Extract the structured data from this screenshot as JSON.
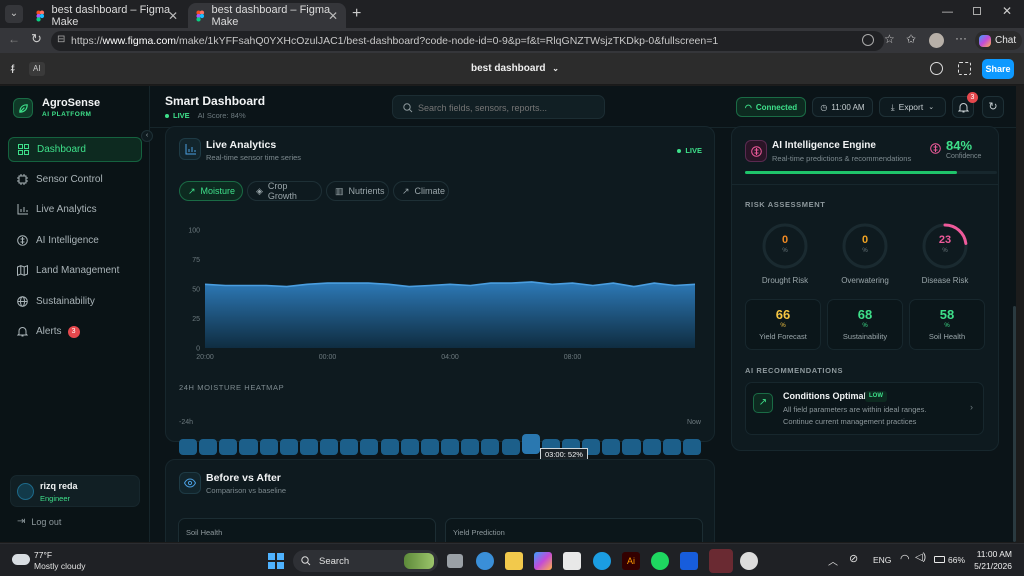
{
  "browser": {
    "tabs": [
      {
        "title": "best dashboard – Figma Make"
      },
      {
        "title": "best dashboard – Figma Make"
      }
    ],
    "url_prefix": "https://",
    "url_domain": "www.figma.com",
    "url_path": "/make/1kYFFsahQ0YXHcOzulJAC1/best-dashboard?code-node-id=0-9&p=f&t=RlqGNZTWsjzTKDkp-0&fullscreen=1",
    "chat_label": "Chat"
  },
  "figma": {
    "ai_badge": "AI",
    "file_title": "best dashboard",
    "share_label": "Share"
  },
  "sidebar": {
    "brand_name": "AgroSense",
    "brand_sub": "AI PLATFORM",
    "items": [
      {
        "label": "Dashboard",
        "icon": "grid-icon"
      },
      {
        "label": "Sensor Control",
        "icon": "cpu-icon"
      },
      {
        "label": "Live Analytics",
        "icon": "bar-chart-icon"
      },
      {
        "label": "AI Intelligence",
        "icon": "brain-icon"
      },
      {
        "label": "Land Management",
        "icon": "map-icon"
      },
      {
        "label": "Sustainability",
        "icon": "globe-icon"
      },
      {
        "label": "Alerts",
        "icon": "bell-icon",
        "badge": "3"
      }
    ],
    "user_name": "rizq reda",
    "user_role": "Engineer",
    "logout_label": "Log out"
  },
  "header": {
    "title": "Smart Dashboard",
    "live_label": "LIVE",
    "ai_score": "AI Score: 84%",
    "search_placeholder": "Search fields, sensors, reports...",
    "connected_label": "Connected",
    "time_label": "11:00 AM",
    "export_label": "Export",
    "notif_count": "3"
  },
  "analytics": {
    "title": "Live Analytics",
    "subtitle": "Real-time sensor time series",
    "live_label": "LIVE",
    "tabs": [
      "Moisture",
      "Crop Growth",
      "Nutrients",
      "Climate"
    ],
    "active_tab": "Moisture",
    "heatmap_title": "24H MOISTURE HEATMAP",
    "heatmap_start": "-24h",
    "heatmap_end": "Now",
    "heatmap_tooltip": "03:00: 52%"
  },
  "chart_data": {
    "type": "area",
    "title": "",
    "xlabel": "",
    "ylabel": "",
    "ylim": [
      0,
      100
    ],
    "y_ticks": [
      "100",
      "75",
      "50",
      "25",
      "0"
    ],
    "x_ticks": [
      "20:00",
      "00:00",
      "04:00",
      "08:00"
    ],
    "color": "#4a9ee0",
    "series": [
      {
        "x": [
          0,
          1,
          2,
          3,
          4,
          5,
          6,
          7,
          8,
          9,
          10,
          11,
          12,
          13,
          14,
          15,
          16,
          17,
          18,
          19,
          20,
          21,
          22,
          23,
          24
        ],
        "values": [
          54,
          53,
          53,
          53,
          52,
          54,
          55,
          55,
          55,
          54,
          52,
          53,
          54,
          53,
          55,
          55,
          56,
          54,
          55,
          53,
          55,
          52,
          55,
          53,
          54
        ]
      }
    ]
  },
  "before_after": {
    "title": "Before vs After",
    "subtitle": "Comparison vs baseline",
    "col1": "Soil Health",
    "col2": "Yield Prediction"
  },
  "ai_engine": {
    "title": "AI Intelligence Engine",
    "subtitle": "Real-time predictions & recommendations",
    "confidence_value": "84%",
    "confidence_label": "Confidence",
    "confidence_fraction": 0.84,
    "risk_title": "RISK ASSESSMENT",
    "risks": [
      {
        "value": "0",
        "unit": "%",
        "label": "Drought Risk",
        "fraction": 0,
        "color": "#f08a24"
      },
      {
        "value": "0",
        "unit": "%",
        "label": "Overwatering",
        "fraction": 0,
        "color": "#f0a424"
      },
      {
        "value": "23",
        "unit": "%",
        "label": "Disease Risk",
        "fraction": 0.23,
        "color": "#ee5a9a"
      }
    ],
    "scores": [
      {
        "value": "66",
        "unit": "%",
        "label": "Yield Forecast",
        "color": "#f5c542"
      },
      {
        "value": "68",
        "unit": "%",
        "label": "Sustainability",
        "color": "#3ee08a"
      },
      {
        "value": "58",
        "unit": "%",
        "label": "Soil Health",
        "color": "#3ee08a"
      }
    ],
    "rec_title": "AI RECOMMENDATIONS",
    "rec_heading": "Conditions Optimal",
    "rec_badge": "LOW",
    "rec_text_1": "All field parameters are within ideal ranges.",
    "rec_text_2": "Continue current management practices"
  },
  "taskbar": {
    "weather_temp": "77°F",
    "weather_desc": "Mostly cloudy",
    "search_label": "Search",
    "lang": "ENG",
    "battery": "66%",
    "time": "11:00 AM",
    "date": "5/21/2026"
  }
}
